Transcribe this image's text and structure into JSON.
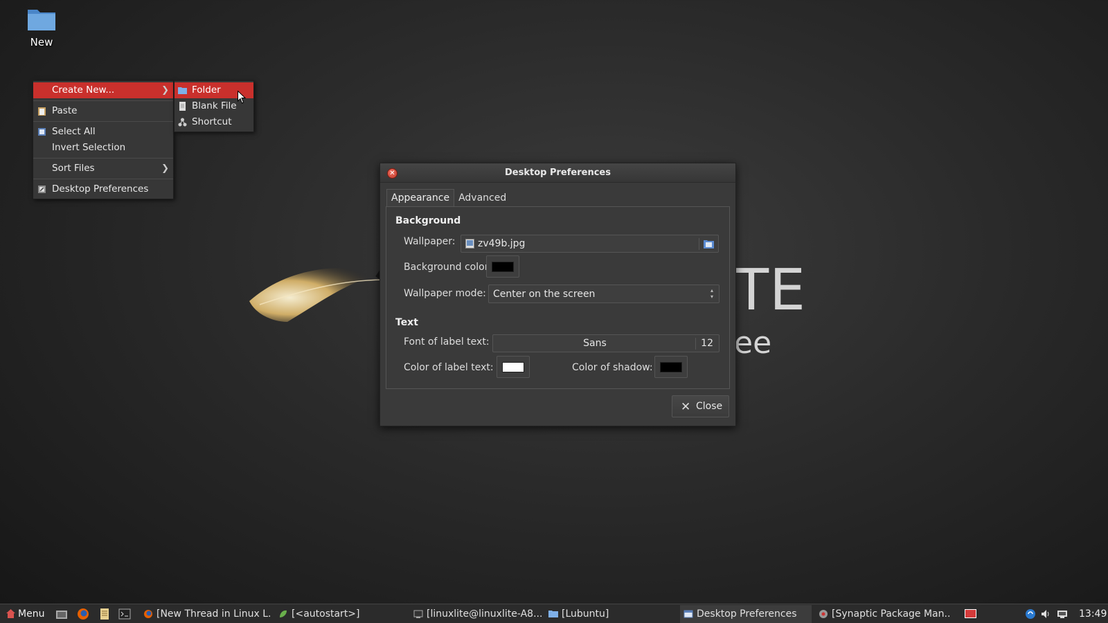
{
  "desktop": {
    "icon_label": "New",
    "brand_big": "TE",
    "brand_small": "ee"
  },
  "context_menu": {
    "items": [
      {
        "label": "Create New...",
        "has_submenu": true,
        "active": true
      },
      {
        "label": "Paste"
      },
      {
        "label": "Select All"
      },
      {
        "label": "Invert Selection"
      },
      {
        "label": "Sort Files",
        "has_submenu": true
      },
      {
        "label": "Desktop Preferences"
      }
    ],
    "submenu": [
      {
        "label": "Folder",
        "active": true
      },
      {
        "label": "Blank File"
      },
      {
        "label": "Shortcut"
      }
    ]
  },
  "dialog": {
    "title": "Desktop Preferences",
    "tabs": [
      {
        "label": "Appearance",
        "active": true
      },
      {
        "label": "Advanced"
      }
    ],
    "background_section": "Background",
    "wallpaper_label": "Wallpaper:",
    "wallpaper_value": "zv49b.jpg",
    "bg_color_label": "Background color:",
    "bg_color": "#000000",
    "wallpaper_mode_label": "Wallpaper mode:",
    "wallpaper_mode_value": "Center on the screen",
    "text_section": "Text",
    "font_label": "Font of label text:",
    "font_family": "Sans",
    "font_size": "12",
    "label_color_label": "Color of label text:",
    "label_color": "#ffffff",
    "shadow_color_label": "Color of shadow:",
    "shadow_color": "#000000",
    "close_label": "Close"
  },
  "taskbar": {
    "menu_label": "Menu",
    "tasks": [
      {
        "label": "[New Thread in Linux L..."
      },
      {
        "label": "[<autostart>]"
      },
      {
        "label": "[linuxlite@linuxlite-A8..."
      },
      {
        "label": "[Lubuntu]"
      },
      {
        "label": "Desktop Preferences",
        "active": true
      },
      {
        "label": "[Synaptic Package Man..."
      }
    ],
    "clock": "13:49"
  },
  "colors": {
    "accent": "#c9302c",
    "menu_bg": "#373737",
    "dialog_bg": "#3a3a3a"
  }
}
